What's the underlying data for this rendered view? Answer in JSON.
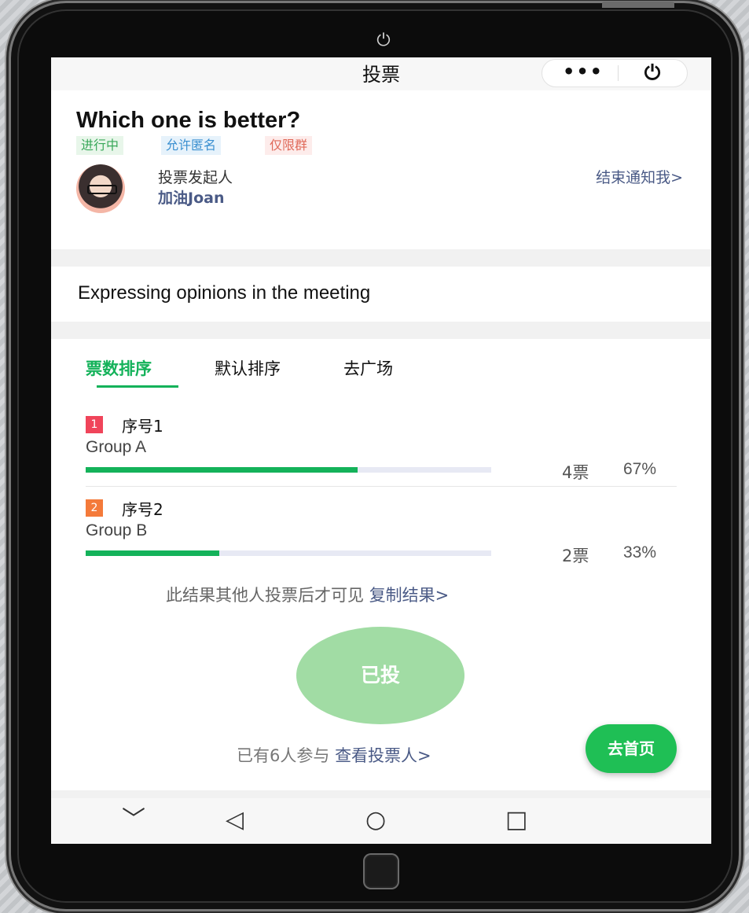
{
  "device": {
    "top_glyph": "⏻"
  },
  "titlebar": {
    "title": "投票",
    "more_label": "•••",
    "close_label": "⏻"
  },
  "poll": {
    "question": "Which one is better?",
    "tags": [
      "进行中",
      "允许匿名",
      "仅限群"
    ],
    "initiator_label": "投票发起人",
    "initiator_name": "加油Joan",
    "notify_link": "结束通知我>",
    "description": "Expressing opinions in the meeting"
  },
  "tabs": [
    {
      "label": "票数排序",
      "active": true
    },
    {
      "label": "默认排序",
      "active": false
    },
    {
      "label": "去广场",
      "active": false
    }
  ],
  "options": [
    {
      "rank": "1",
      "rank_color": "#f0445a",
      "seq": "序号1",
      "name": "Group A",
      "count": "4票",
      "percent": "67%",
      "fraction": 0.67
    },
    {
      "rank": "2",
      "rank_color": "#f47a3a",
      "seq": "序号2",
      "name": "Group B",
      "count": "2票",
      "percent": "33%",
      "fraction": 0.33
    }
  ],
  "result_note": {
    "text": "此结果其他人投票后才可见",
    "link": "复制结果>"
  },
  "vote_button": {
    "label": "已投"
  },
  "participants": {
    "text": "已有6人参与",
    "link": "查看投票人>"
  },
  "home_button": {
    "label": "去首页"
  },
  "navbar": {
    "down": "﹀",
    "back": "◁",
    "home": "○",
    "recent": "□"
  },
  "colors": {
    "accent": "#14b25a",
    "link": "#4a5a86"
  }
}
